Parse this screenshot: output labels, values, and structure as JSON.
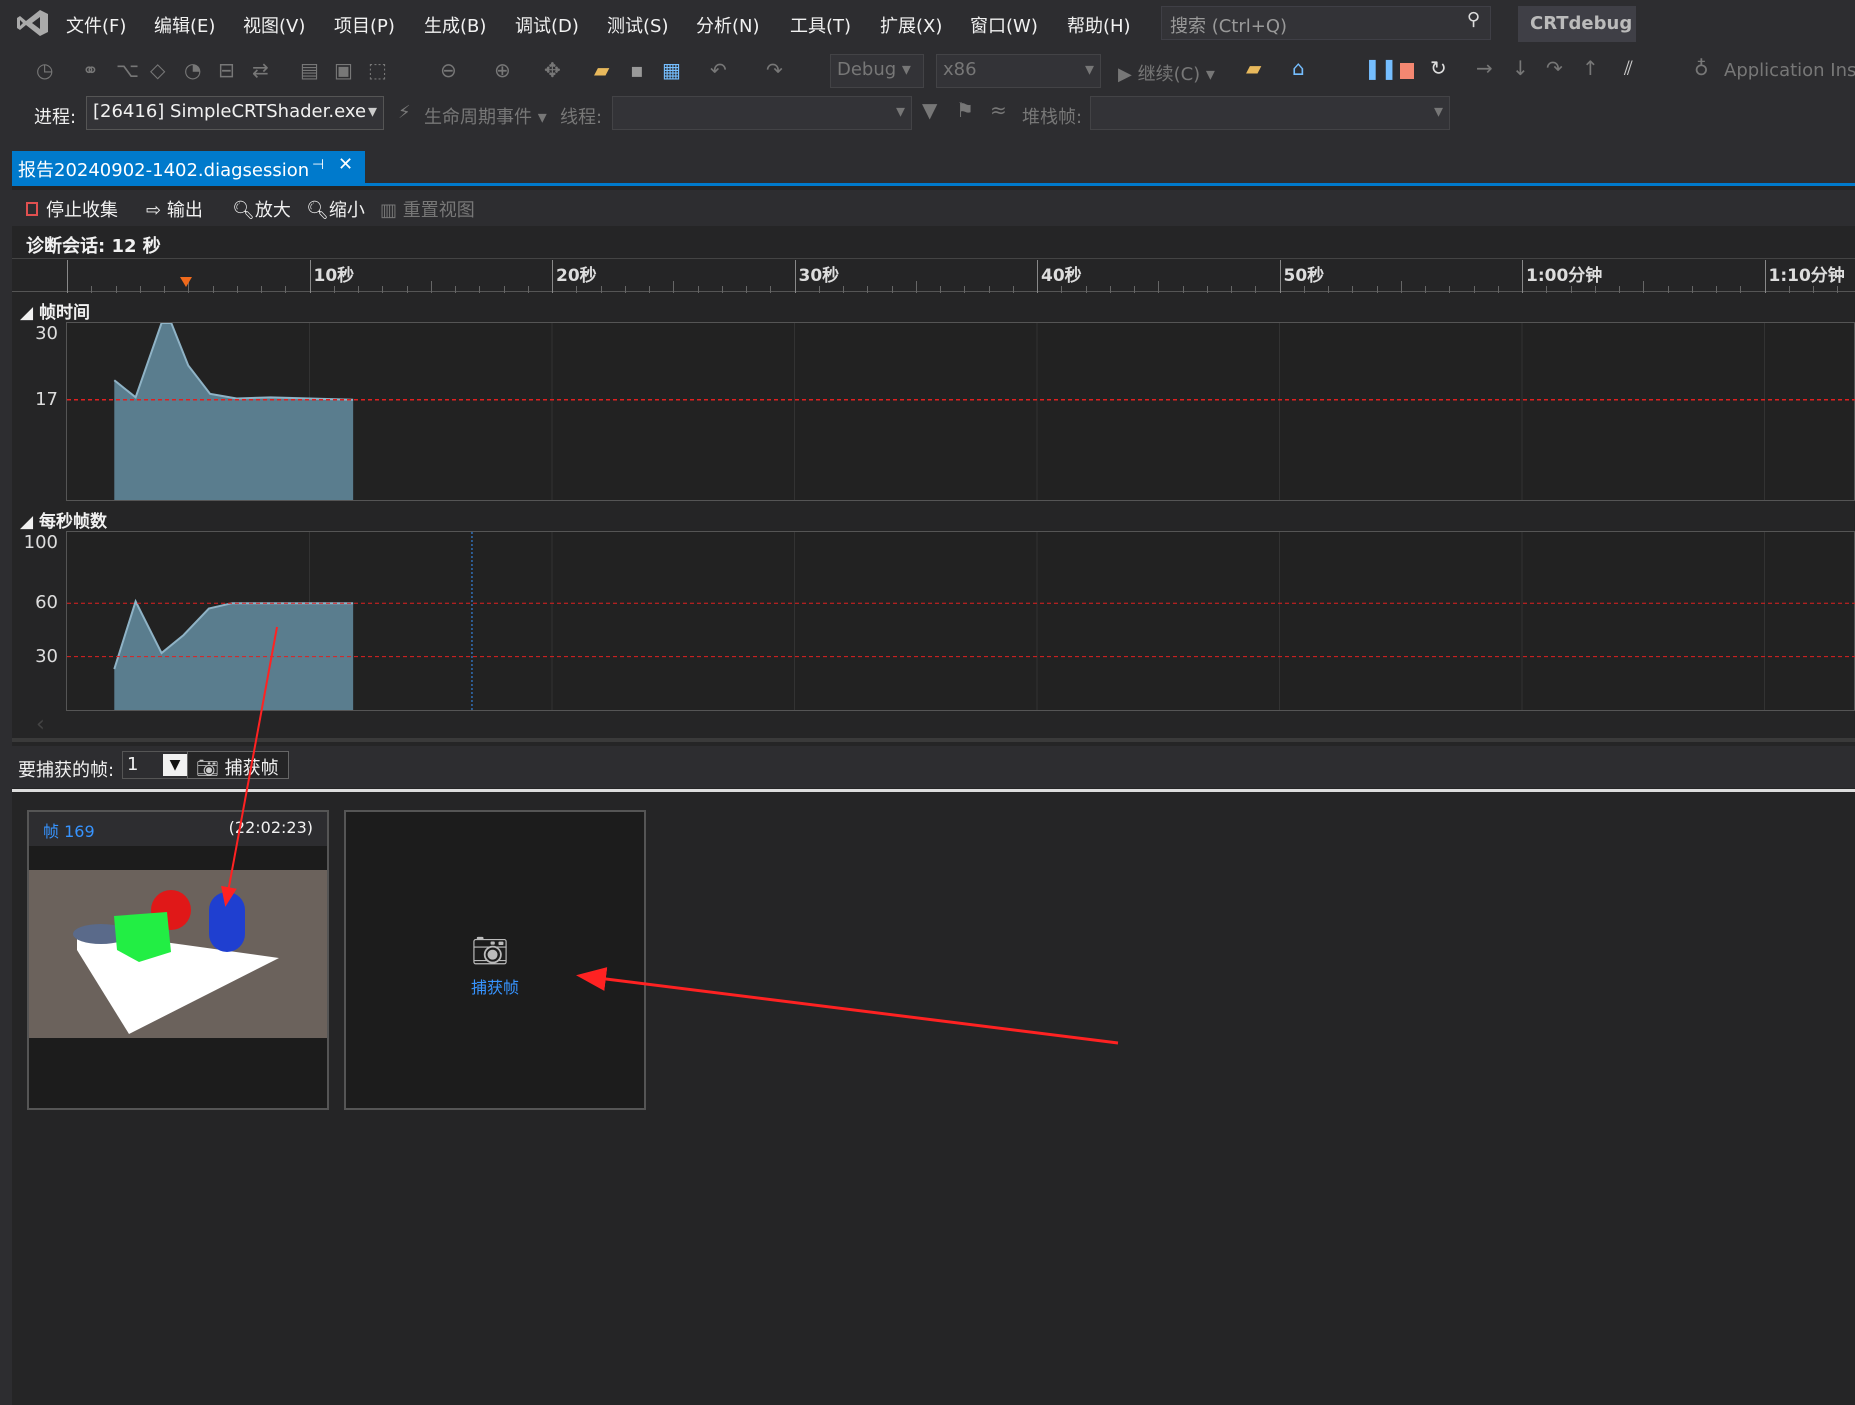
{
  "menu": {
    "items": [
      "文件(F)",
      "编辑(E)",
      "视图(V)",
      "项目(P)",
      "生成(B)",
      "调试(D)",
      "测试(S)",
      "分析(N)",
      "工具(T)",
      "扩展(X)",
      "窗口(W)",
      "帮助(H)"
    ],
    "search_placeholder": "搜索 (Ctrl+Q)",
    "user": "CRTdebug"
  },
  "toolbar": {
    "config": "Debug",
    "platform": "x86",
    "continue": "继续(C)",
    "app_insights": "Application Insights",
    "process_label": "进程:",
    "process_value": "[26416] SimpleCRTShader.exe",
    "lifecycle": "生命周期事件",
    "thread_label": "线程:",
    "stack_label": "堆栈帧:"
  },
  "tab": {
    "title": "报告20240902-1402.diagsession"
  },
  "diag_toolbar": {
    "stop": "停止收集",
    "output": "输出",
    "zoom_in": "放大",
    "zoom_out": "缩小",
    "reset": "重置视图"
  },
  "session": "诊断会话: 12 秒",
  "ruler": {
    "labels": [
      "10秒",
      "20秒",
      "30秒",
      "40秒",
      "50秒",
      "1:00分钟",
      "1:10分钟"
    ],
    "ticks_s": [
      10,
      20,
      30,
      40,
      50,
      60,
      70
    ],
    "marker_s": 4.9
  },
  "colors": {
    "accent": "#007acc",
    "area": "#5a7d8e",
    "area_line": "#8fb3c6",
    "threshold": "#e02020",
    "link": "#3794ff"
  },
  "chart_data": [
    {
      "type": "area",
      "title": "帧时间",
      "ylim": [
        0,
        30
      ],
      "yticks": [
        30,
        17
      ],
      "threshold": [
        17
      ],
      "x": [
        1.95,
        2.83,
        3.9,
        4.3,
        5.0,
        5.9,
        7.0,
        8.4,
        11.8
      ],
      "values": [
        20.3,
        17.4,
        30,
        30,
        22.8,
        18,
        17.2,
        17.4,
        17
      ]
    },
    {
      "type": "area",
      "title": "每秒帧数",
      "ylim": [
        0,
        100
      ],
      "yticks": [
        100,
        60,
        30
      ],
      "threshold": [
        60,
        30
      ],
      "cursor_s": 16.7,
      "x": [
        1.95,
        2.83,
        3.9,
        4.8,
        5.85,
        6.8,
        11.8
      ],
      "values": [
        23,
        61,
        32,
        42,
        57,
        60,
        60
      ]
    }
  ],
  "capture": {
    "label": "要捕获的帧:",
    "count": "1",
    "button": "捕获帧"
  },
  "frames": [
    {
      "title": "帧 169",
      "time": "(22:02:23)"
    }
  ],
  "placeholder": {
    "label": "捕获帧"
  }
}
